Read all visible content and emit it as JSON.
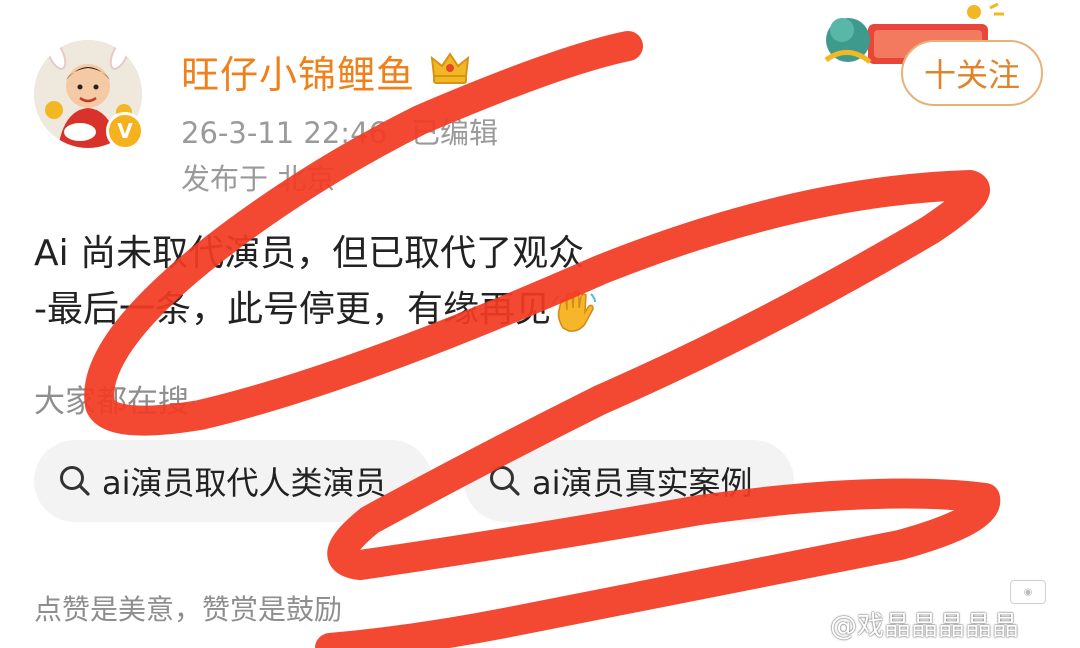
{
  "author": {
    "name": "旺仔小锦鲤鱼",
    "badge_icon": "crown-icon",
    "verified_icon": "verified-v-icon",
    "name_color": "#f0801a"
  },
  "meta": {
    "timestamp": "26-3-11 22:46",
    "edited": "已编辑",
    "location": "发布于 北京"
  },
  "follow_button": {
    "label": "十关注"
  },
  "post": {
    "line1": "Ai 尚未取代演员，但已取代了观众",
    "line2": "-最后一条，此号停更，有缘再见",
    "emoji": "waving-hand-icon"
  },
  "search": {
    "heading": "大家都在搜",
    "chips": [
      {
        "label": "ai演员取代人类演员"
      },
      {
        "label": "ai演员真实案例"
      }
    ]
  },
  "footer": {
    "reward_text": "点赞是美意，赞赏是鼓励"
  },
  "watermark": {
    "text": "@戏晶晶晶晶晶"
  },
  "colors": {
    "scribble": "#f23a22",
    "accent": "#e0832b"
  }
}
